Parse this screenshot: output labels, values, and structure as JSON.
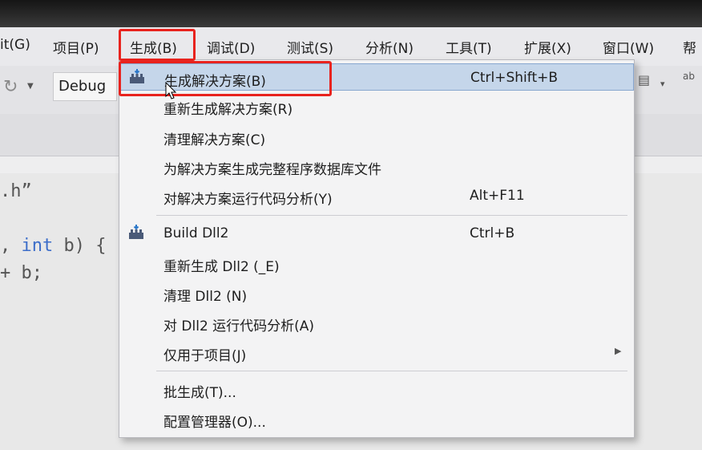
{
  "menubar": {
    "items": [
      {
        "label": "it(G)"
      },
      {
        "label": "项目(P)"
      },
      {
        "label": "生成(B)"
      },
      {
        "label": "调试(D)"
      },
      {
        "label": "测试(S)"
      },
      {
        "label": "分析(N)"
      },
      {
        "label": "工具(T)"
      },
      {
        "label": "扩展(X)"
      },
      {
        "label": "窗口(W)"
      },
      {
        "label": "帮"
      }
    ]
  },
  "toolbar": {
    "configuration": "Debug"
  },
  "editor": {
    "line1": ".h”",
    "line2_prefix": ", ",
    "line2_keyword": "int",
    "line2_suffix": " b) {",
    "line3": "+ b;"
  },
  "build_menu": {
    "items": [
      {
        "label": "生成解决方案(B)",
        "shortcut": "Ctrl+Shift+B",
        "icon": "build-icon",
        "highlighted": true
      },
      {
        "label": "重新生成解决方案(R)",
        "shortcut": ""
      },
      {
        "label": "清理解决方案(C)",
        "shortcut": ""
      },
      {
        "label": "为解决方案生成完整程序数据库文件",
        "shortcut": ""
      },
      {
        "label": "对解决方案运行代码分析(Y)",
        "shortcut": "Alt+F11"
      },
      {
        "label": "Build Dll2",
        "shortcut": "Ctrl+B",
        "icon": "build-icon"
      },
      {
        "label": "重新生成 Dll2 (_E)",
        "shortcut": ""
      },
      {
        "label": "清理 Dll2 (N)",
        "shortcut": ""
      },
      {
        "label": "对 Dll2 运行代码分析(A)",
        "shortcut": ""
      },
      {
        "label": "仅用于项目(J)",
        "shortcut": "",
        "submenu": true
      },
      {
        "label": "批生成(T)...",
        "shortcut": ""
      },
      {
        "label": "配置管理器(O)...",
        "shortcut": ""
      }
    ]
  },
  "colors": {
    "highlight_box": "#e8231e",
    "menu_highlight": "#c5d6ea"
  }
}
